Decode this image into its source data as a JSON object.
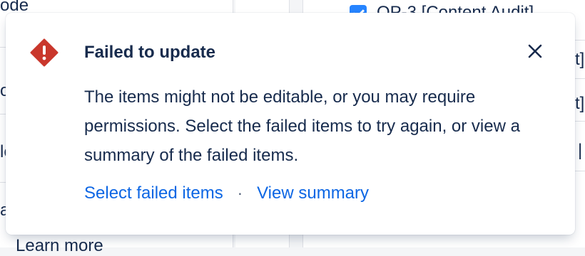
{
  "background": {
    "left_fragments": [
      "ode",
      "o",
      "le",
      "a",
      "Learn more"
    ],
    "right_row_top": "OP-3 [Content Audit]",
    "right_fragments": [
      "t]",
      "t]",
      "|"
    ]
  },
  "flag": {
    "icon": "error-diamond-icon",
    "icon_color": "#c9372c",
    "title": "Failed to update",
    "description": "The items might not be editable, or you may require permissions. Select the failed items to try again, or view a summary of the failed items.",
    "actions": {
      "select_failed": "Select failed items",
      "separator": "·",
      "view_summary": "View summary"
    },
    "close_icon": "close-icon"
  }
}
